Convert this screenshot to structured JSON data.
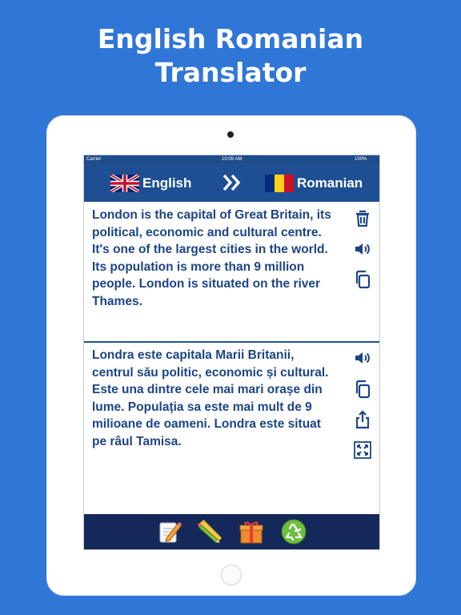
{
  "headline": {
    "line1": "English Romanian",
    "line2": "Translator"
  },
  "status_bar": {
    "carrier": "Carrier",
    "time": "10:09 AM",
    "battery": "100%"
  },
  "nav": {
    "source_language": "English",
    "target_language": "Romanian",
    "source_flag_icon": "uk-flag-icon",
    "target_flag_icon": "romania-flag-icon",
    "swap_icon": "double-chevron-right-icon"
  },
  "source_panel": {
    "text": "London is the capital of Great Britain, its political, economic and cultural centre. It's one of the largest cities in the world. Its population is more than 9 million people. London is situated on the river Thames.",
    "tools": [
      "trash-icon",
      "speaker-icon",
      "copy-icon"
    ]
  },
  "target_panel": {
    "text": "Londra este capitala Marii Britanii, centrul său politic, economic și cultural. Este una dintre cele mai mari orașe din lume. Populația sa este mai mult de 9 milioane de oameni. Londra este situat pe râul Tamisa.",
    "tools": [
      "speaker-icon",
      "copy-icon",
      "share-icon",
      "fullscreen-icon"
    ]
  },
  "bottom_bar": {
    "items": [
      "notepad-pencil-icon",
      "ruler-pencil-icon",
      "gift-icon",
      "recycle-icon"
    ]
  },
  "colors": {
    "background": "#2f76d6",
    "nav_bar": "#1e4f93",
    "text": "#1c4587",
    "bottom_bar": "#14285a"
  }
}
